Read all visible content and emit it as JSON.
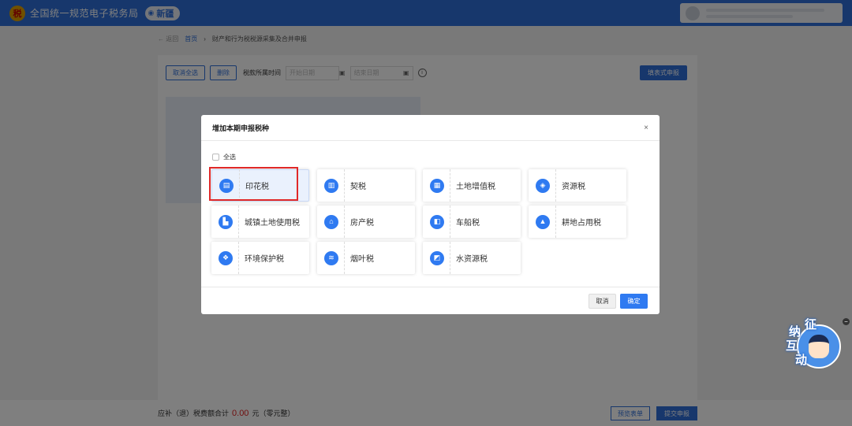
{
  "header": {
    "site_title": "全国统一规范电子税务局",
    "region": "新疆"
  },
  "breadcrumb": {
    "back": "返回",
    "home": "首页",
    "current": "财产和行为税税源采集及合并申报"
  },
  "toolbar": {
    "cancel_select": "取消全选",
    "delete": "删除",
    "period_label": "税款所属时间",
    "start_date_placeholder": "开始日期",
    "end_date_placeholder": "结束日期",
    "form_declare": "填表式申报"
  },
  "footer": {
    "total_label": "应补（退）税费额合计",
    "total_amount": "0.00",
    "total_unit": "元（零元整）",
    "preview": "预览表单",
    "submit": "提交申报"
  },
  "modal": {
    "title": "增加本期申报税种",
    "close": "×",
    "select_all": "全选",
    "taxes": [
      {
        "label": "印花税",
        "icon": "stamp-duty-icon",
        "selected": true
      },
      {
        "label": "契税",
        "icon": "deed-tax-icon",
        "selected": false
      },
      {
        "label": "土地增值税",
        "icon": "land-appreciation-tax-icon",
        "selected": false
      },
      {
        "label": "资源税",
        "icon": "resource-tax-icon",
        "selected": false
      },
      {
        "label": "城镇土地使用税",
        "icon": "urban-land-use-tax-icon",
        "selected": false
      },
      {
        "label": "房产税",
        "icon": "property-tax-icon",
        "selected": false
      },
      {
        "label": "车船税",
        "icon": "vehicle-vessel-tax-icon",
        "selected": false
      },
      {
        "label": "耕地占用税",
        "icon": "farmland-occupation-tax-icon",
        "selected": false
      },
      {
        "label": "环境保护税",
        "icon": "environmental-tax-icon",
        "selected": false
      },
      {
        "label": "烟叶税",
        "icon": "tobacco-leaf-tax-icon",
        "selected": false
      },
      {
        "label": "水资源税",
        "icon": "water-resource-tax-icon",
        "selected": false
      }
    ],
    "cancel": "取消",
    "confirm": "确定"
  },
  "helper": {
    "chars": [
      "征",
      "纳",
      "互",
      "动"
    ]
  },
  "colors": {
    "brand_blue": "#2f6fd8",
    "icon_blue": "#2f7af1",
    "highlight_red": "#e02828",
    "amount_red": "#e02020"
  }
}
